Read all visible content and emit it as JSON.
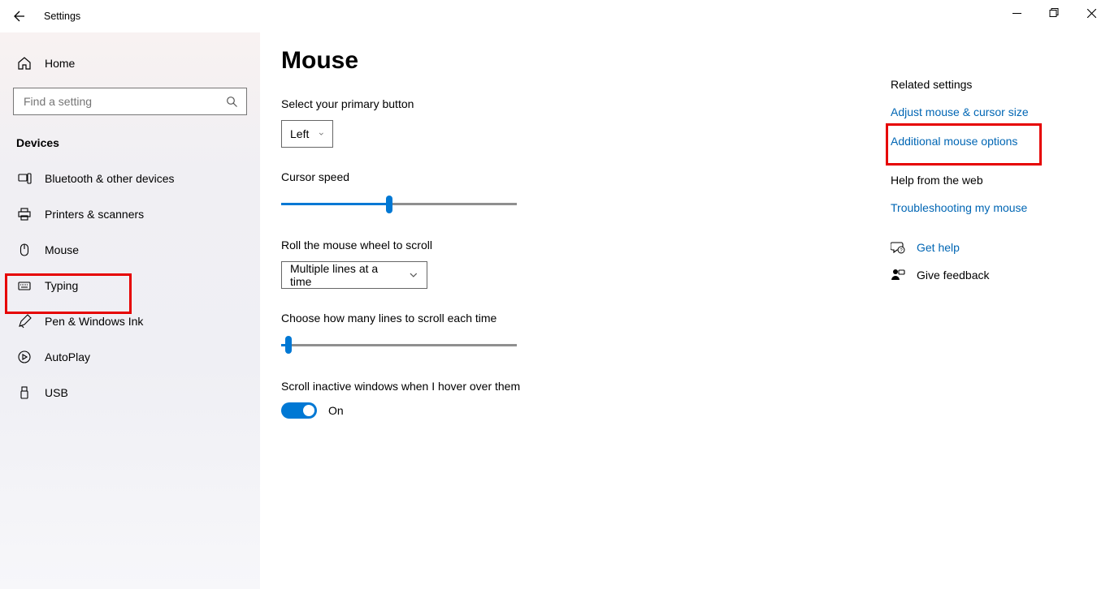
{
  "titlebar": {
    "title": "Settings"
  },
  "leftnav": {
    "home_label": "Home",
    "search_placeholder": "Find a setting",
    "section_label": "Devices",
    "items": [
      {
        "label": "Bluetooth & other devices"
      },
      {
        "label": "Printers & scanners"
      },
      {
        "label": "Mouse"
      },
      {
        "label": "Typing"
      },
      {
        "label": "Pen & Windows Ink"
      },
      {
        "label": "AutoPlay"
      },
      {
        "label": "USB"
      }
    ]
  },
  "main": {
    "page_title": "Mouse",
    "primary_button_label": "Select your primary button",
    "primary_button_value": "Left",
    "cursor_speed_label": "Cursor speed",
    "cursor_speed_percent": 46,
    "scroll_mode_label": "Roll the mouse wheel to scroll",
    "scroll_mode_value": "Multiple lines at a time",
    "lines_label": "Choose how many lines to scroll each time",
    "lines_percent": 3,
    "hover_label": "Scroll inactive windows when I hover over them",
    "hover_state": "On"
  },
  "right": {
    "related_heading": "Related settings",
    "links": [
      "Adjust mouse & cursor size",
      "Additional mouse options"
    ],
    "help_heading": "Help from the web",
    "help_links": [
      "Troubleshooting my mouse"
    ],
    "get_help": "Get help",
    "give_feedback": "Give feedback"
  }
}
